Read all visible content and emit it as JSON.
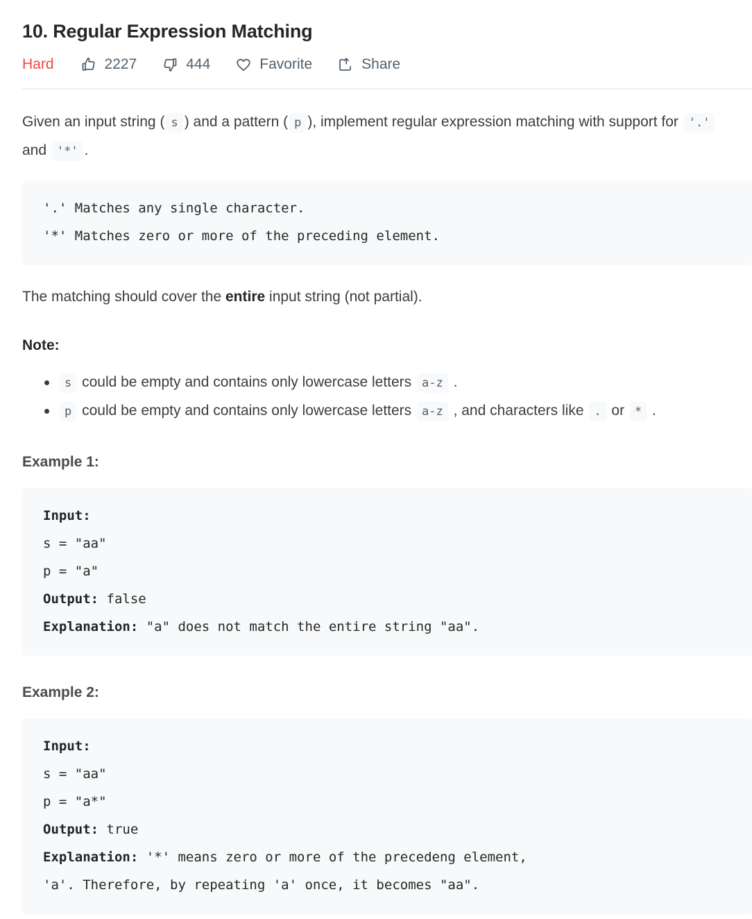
{
  "header": {
    "title": "10. Regular Expression Matching",
    "difficulty": "Hard",
    "difficulty_color": "#ef4743",
    "likes": "2227",
    "dislikes": "444",
    "favorite_label": "Favorite",
    "share_label": "Share",
    "icons": {
      "like": "thumbs-up-icon",
      "dislike": "thumbs-down-icon",
      "favorite": "heart-icon",
      "share": "share-icon"
    }
  },
  "description": {
    "p1_a": "Given an input string (",
    "p1_code_s": "s",
    "p1_b": ") and a pattern (",
    "p1_code_p": "p",
    "p1_c": "), implement regular expression matching with support for ",
    "p1_code_dot": "'.'",
    "p1_d": " and ",
    "p1_code_star": "'*'",
    "p1_e": ".",
    "rules_block": "'.' Matches any single character.\n'*' Matches zero or more of the preceding element.",
    "p2_a": "The matching should cover the ",
    "p2_bold": "entire",
    "p2_b": " input string (not partial).",
    "note_heading": "Note:",
    "notes": [
      {
        "code1": "s",
        "text1": " could be empty and contains only lowercase letters ",
        "code2": "a-z",
        "text2": " ."
      },
      {
        "code1": "p",
        "text1": " could be empty and contains only lowercase letters ",
        "code2": "a-z",
        "text2": " , and characters like ",
        "code3": ".",
        "text3": " or ",
        "code4": "*",
        "text4": " ."
      }
    ]
  },
  "examples": [
    {
      "heading": "Example 1:",
      "input_label": "Input:",
      "s_line": "s = \"aa\"",
      "p_line": "p = \"a\"",
      "output_label": "Output:",
      "output_value": " false",
      "explanation_label": "Explanation:",
      "explanation_value": " \"a\" does not match the entire string \"aa\"."
    },
    {
      "heading": "Example 2:",
      "input_label": "Input:",
      "s_line": "s = \"aa\"",
      "p_line": "p = \"a*\"",
      "output_label": "Output:",
      "output_value": " true",
      "explanation_label": "Explanation:",
      "explanation_value": " '*' means zero or more of the precedeng element,",
      "explanation_value_line2": "'a'. Therefore, by repeating 'a' once, it becomes \"aa\"."
    }
  ]
}
